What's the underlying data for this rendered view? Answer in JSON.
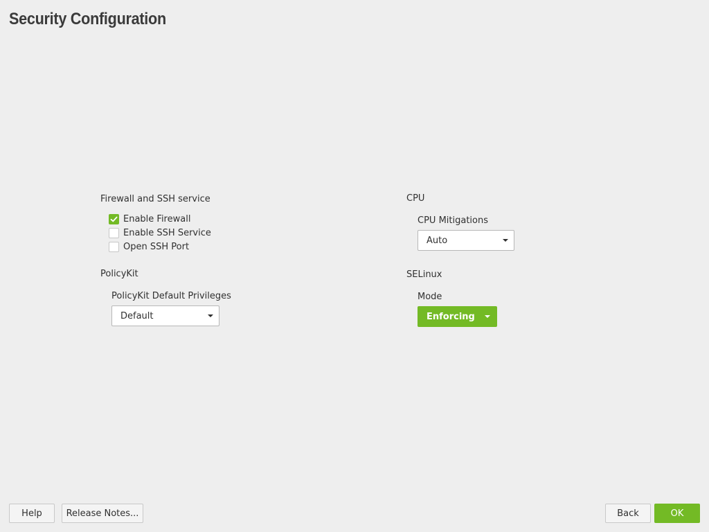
{
  "page": {
    "title": "Security Configuration"
  },
  "firewall": {
    "group_title": "Firewall and SSH service",
    "items": [
      {
        "label": "Enable Firewall",
        "checked": true
      },
      {
        "label": "Enable SSH Service",
        "checked": false
      },
      {
        "label": "Open SSH Port",
        "checked": false
      }
    ]
  },
  "policykit": {
    "group_title": "PolicyKit",
    "field_label": "PolicyKit Default Privileges",
    "selected": "Default"
  },
  "cpu": {
    "group_title": "CPU",
    "field_label": "CPU Mitigations",
    "selected": "Auto"
  },
  "selinux": {
    "group_title": "SELinux",
    "field_label": "Mode",
    "selected": "Enforcing"
  },
  "footer": {
    "help_label": "Help",
    "release_notes_label": "Release Notes...",
    "back_label": "Back",
    "ok_label": "OK"
  },
  "colors": {
    "accent": "#73ba25",
    "background": "#eeeeee"
  },
  "icons": {
    "checkbox_checked": "check-icon",
    "dropdown": "chevron-down-icon"
  }
}
